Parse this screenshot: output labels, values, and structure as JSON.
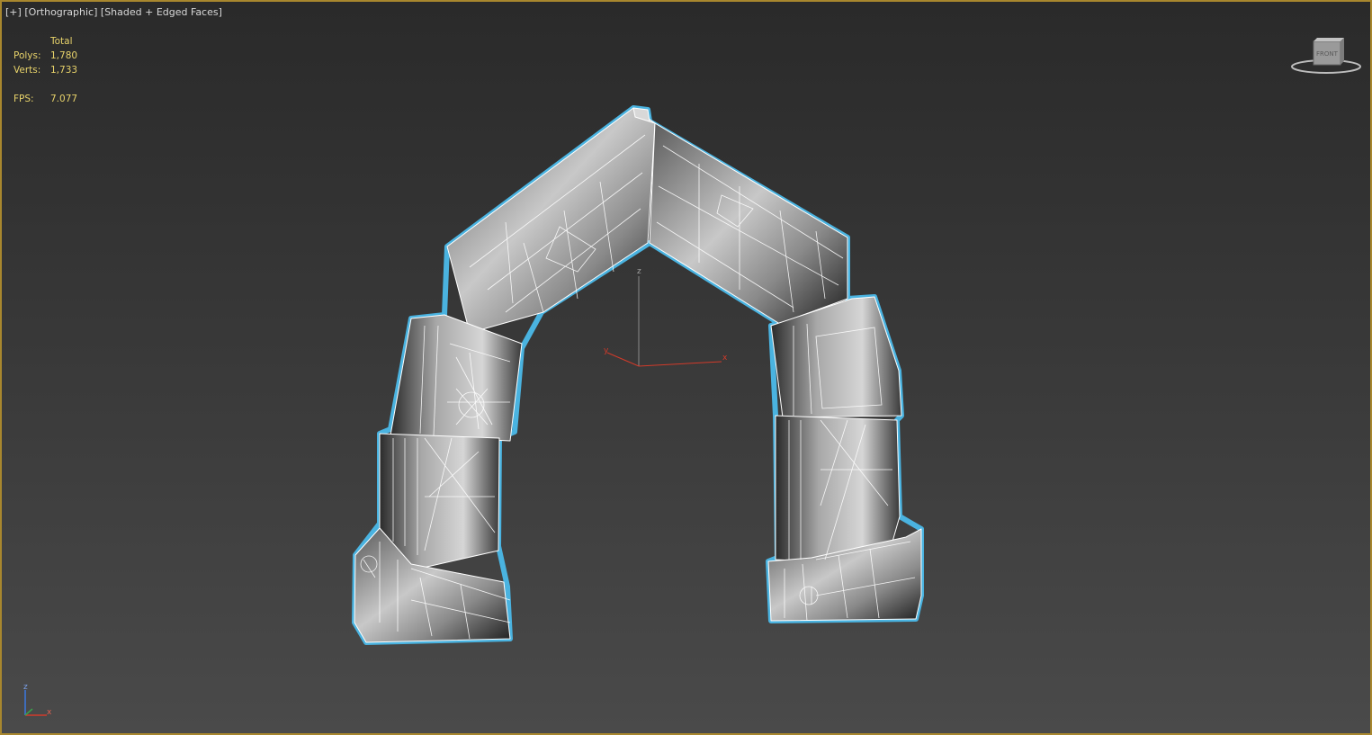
{
  "viewport": {
    "menu_label": "[+]",
    "view_label": "[Orthographic]",
    "shading_label": "[Shaded + Edged Faces]"
  },
  "stats": {
    "header": "Total",
    "polys_label": "Polys:",
    "polys_value": "1,780",
    "verts_label": "Verts:",
    "verts_value": "1,733",
    "fps_label": "FPS:",
    "fps_value": "7.077"
  },
  "gizmo": {
    "z_label": "z",
    "y_label": "y",
    "x_label": "x"
  },
  "world_axis": {
    "z_label": "z",
    "x_label": "x"
  },
  "viewcube": {
    "face_label": "FRONT"
  },
  "colors": {
    "frame": "#a8872e",
    "stats_text": "#e8d36a",
    "selection_outline": "#4ab3e0",
    "wire": "#ffffff",
    "axis_x": "#d23a2a",
    "axis_z": "#3a78e0"
  }
}
